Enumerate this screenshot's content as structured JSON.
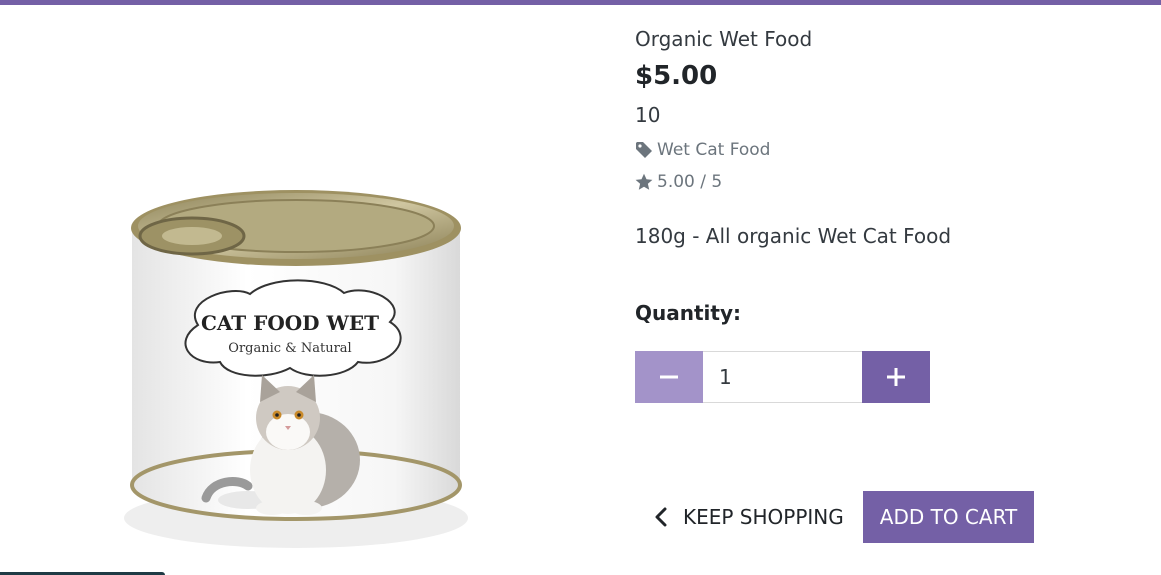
{
  "product": {
    "name": "Organic Wet Food",
    "price": "$5.00",
    "stock": "10",
    "category": "Wet Cat Food",
    "rating": "5.00 / 5",
    "description": "180g - All organic Wet Cat Food",
    "image": {
      "label_title": "CAT FOOD WET",
      "label_subtitle": "Organic & Natural"
    }
  },
  "quantity": {
    "label": "Quantity:",
    "value": "1"
  },
  "actions": {
    "keep_shopping": "KEEP SHOPPING",
    "add_to_cart": "ADD TO CART"
  },
  "icons": {
    "category": "tag-icon",
    "rating": "star-icon",
    "decrement": "minus-icon",
    "increment": "plus-icon",
    "back": "chevron-left-icon"
  },
  "colors": {
    "accent": "#7460a6",
    "accent_light": "#a393c9",
    "muted": "#6c757d"
  }
}
